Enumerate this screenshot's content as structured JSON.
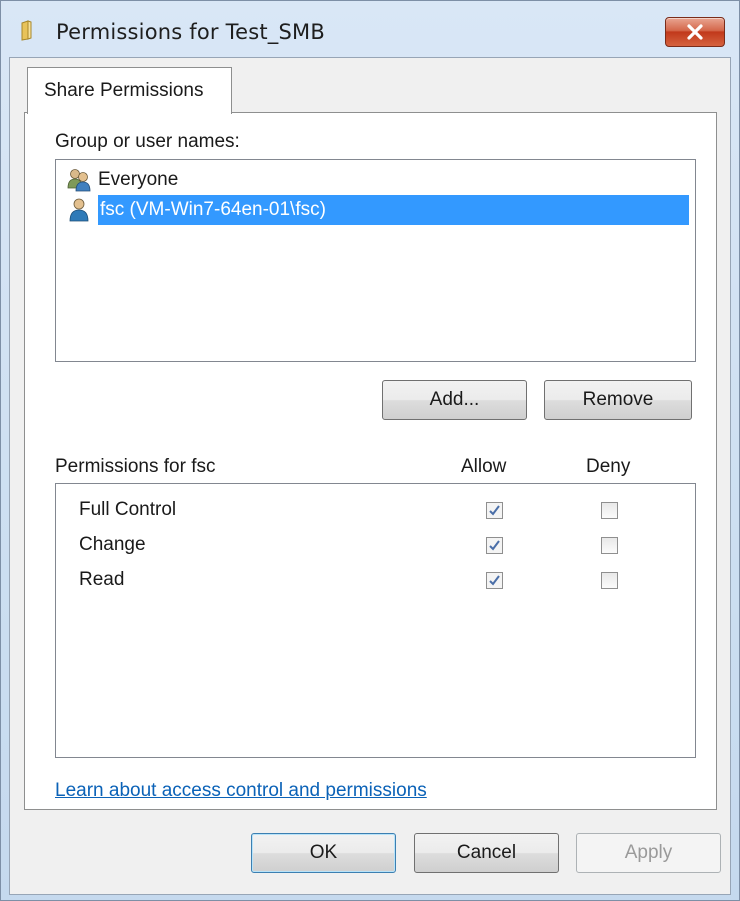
{
  "window": {
    "title": "Permissions for Test_SMB",
    "icon": "folder-icon",
    "close_icon": "close-icon"
  },
  "tabs": [
    {
      "label": "Share Permissions",
      "selected": true
    }
  ],
  "group_section": {
    "label": "Group or user names:",
    "items": [
      {
        "name": "Everyone",
        "icon": "group-users-icon",
        "selected": false
      },
      {
        "name": "fsc (VM-Win7-64en-01\\fsc)",
        "icon": "user-icon",
        "selected": true
      }
    ]
  },
  "group_buttons": {
    "add": "Add...",
    "remove": "Remove"
  },
  "permissions": {
    "label": "Permissions for fsc",
    "allow_header": "Allow",
    "deny_header": "Deny",
    "rows": [
      {
        "name": "Full Control",
        "allow": true,
        "deny": false
      },
      {
        "name": "Change",
        "allow": true,
        "deny": false
      },
      {
        "name": "Read",
        "allow": true,
        "deny": false
      }
    ]
  },
  "help_link": "Learn about access control and permissions",
  "footer": {
    "ok": "OK",
    "cancel": "Cancel",
    "apply": "Apply"
  },
  "colors": {
    "selection": "#3399ff",
    "link": "#0b62b7",
    "close_button": "#c1391b"
  }
}
